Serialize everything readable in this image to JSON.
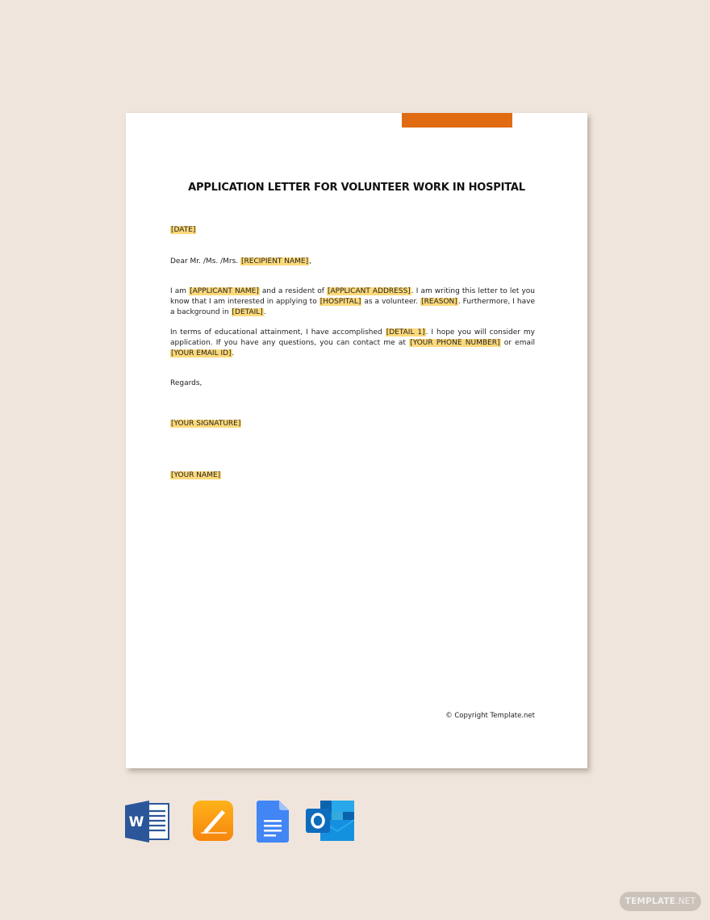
{
  "document": {
    "title": "APPLICATION LETTER FOR VOLUNTEER WORK IN HOSPITAL",
    "accent_color": "#e06b12",
    "highlight_color": "#fdd97a",
    "date_placeholder": "[DATE]",
    "salutation": {
      "prefix": "Dear Mr. /Ms. /Mrs. ",
      "recipient": "[RECIPIENT NAME]",
      "suffix": ","
    },
    "paragraph1": {
      "t1": "I am ",
      "applicant_name": "[APPLICANT NAME]",
      "t2": " and a resident of ",
      "applicant_address": "[APPLICANT ADDRESS]",
      "t3": ". I am writing this letter to let you know that I am interested in applying to ",
      "hospital": "[HOSPITAL]",
      "t4": " as a volunteer. ",
      "reason": "[REASON]",
      "t5": ". Furthermore, I have a background in ",
      "detail": "[DETAIL]",
      "t6": "."
    },
    "paragraph2": {
      "t1": "In terms of educational attainment, I have accomplished ",
      "detail1": "[DETAIL 1]",
      "t2": ". I hope you will consider my application. If you have any questions, you can contact me at ",
      "phone": "[YOUR PHONE NUMBER]",
      "t3": " or email ",
      "email": "[YOUR EMAIL ID]",
      "t4": "."
    },
    "closing": "Regards,",
    "signature_placeholder": "[YOUR SIGNATURE]",
    "name_placeholder": "[YOUR NAME]",
    "copyright": "© Copyright Template.net"
  },
  "formats": [
    {
      "name": "Microsoft Word",
      "icon": "word-icon"
    },
    {
      "name": "Apple Pages",
      "icon": "pages-icon"
    },
    {
      "name": "Google Docs",
      "icon": "google-docs-icon"
    },
    {
      "name": "Microsoft Outlook",
      "icon": "outlook-icon"
    }
  ],
  "watermark": {
    "bold": "TEMPLATE",
    "thin": ".NET"
  }
}
